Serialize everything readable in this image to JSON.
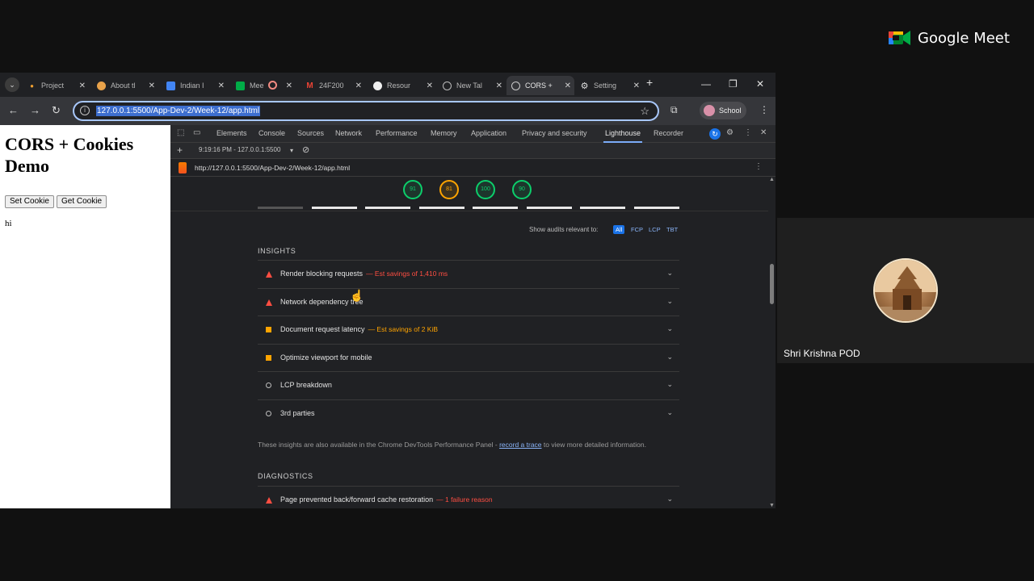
{
  "meet": {
    "brand": "Google Meet",
    "participant_name": "Shri Krishna POD"
  },
  "browser": {
    "tabs": [
      {
        "label": "Project",
        "icon": "dot-icon"
      },
      {
        "label": "About tl",
        "icon": "emoji-icon"
      },
      {
        "label": "Indian I",
        "icon": "square-logo-icon"
      },
      {
        "label": "Mee",
        "icon": "meet-icon"
      },
      {
        "label": "24F200",
        "icon": "gmail-icon"
      },
      {
        "label": "Resour",
        "icon": "github-icon"
      },
      {
        "label": "New Tal",
        "icon": "globe-icon"
      },
      {
        "label": "CORS +",
        "icon": "globe-icon",
        "active": true
      },
      {
        "label": "Setting",
        "icon": "gear-icon"
      }
    ],
    "url": "127.0.0.1:5500/App-Dev-2/Week-12/app.html",
    "profile_label": "School"
  },
  "page": {
    "heading": "CORS + Cookies Demo",
    "set_cookie_label": "Set Cookie",
    "get_cookie_label": "Get Cookie",
    "text": "hi"
  },
  "devtools": {
    "tabs": [
      "Elements",
      "Console",
      "Sources",
      "Network",
      "Performance",
      "Memory",
      "Application",
      "Privacy and security",
      "Lighthouse",
      "Recorder"
    ],
    "active_tab": "Lighthouse",
    "run_time": "9:19:16 PM - 127.0.0.1:5500",
    "report_url": "http://127.0.0.1:5500/App-Dev-2/Week-12/app.html",
    "scores": [
      {
        "value": "91",
        "color": "#0cce6b"
      },
      {
        "value": "81",
        "color": "#ffa400"
      },
      {
        "value": "100",
        "color": "#0cce6b"
      },
      {
        "value": "90",
        "color": "#0cce6b"
      }
    ],
    "filter": {
      "label": "Show audits relevant to:",
      "chips": [
        "All",
        "FCP",
        "LCP",
        "TBT"
      ]
    },
    "insights_title": "INSIGHTS",
    "insights": [
      {
        "title": "Render blocking requests",
        "savings": "— Est savings of 1,410 ms",
        "level": "fail"
      },
      {
        "title": "Network dependency tree",
        "savings": "",
        "level": "fail"
      },
      {
        "title": "Document request latency",
        "savings": "— Est savings of 2 KiB",
        "level": "avg"
      },
      {
        "title": "Optimize viewport for mobile",
        "savings": "",
        "level": "avg"
      },
      {
        "title": "LCP breakdown",
        "savings": "",
        "level": "info"
      },
      {
        "title": "3rd parties",
        "savings": "",
        "level": "info"
      }
    ],
    "insights_note_pre": "These insights are also available in the Chrome DevTools Performance Panel -",
    "insights_note_link": "record a trace",
    "insights_note_post": "to view more detailed information.",
    "diagnostics_title": "DIAGNOSTICS",
    "diagnostics": [
      {
        "title": "Page prevented back/forward cache restoration",
        "savings": "— 1 failure reason",
        "level": "fail"
      }
    ]
  }
}
